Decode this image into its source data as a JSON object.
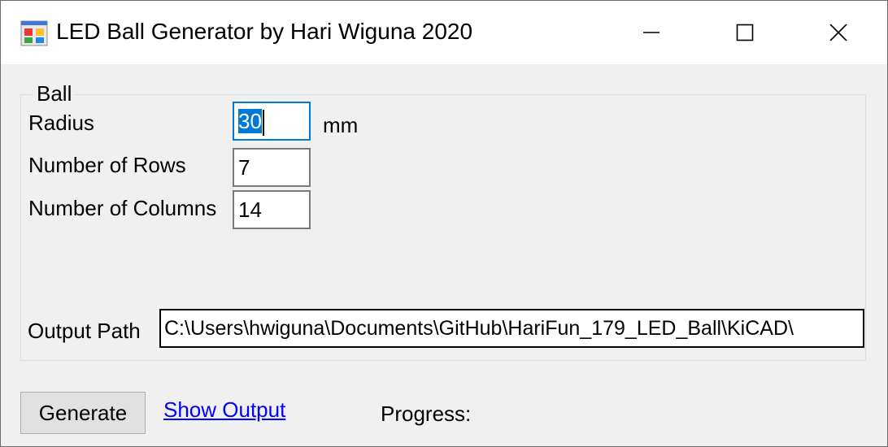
{
  "window": {
    "title": "LED Ball Generator by Hari Wiguna 2020",
    "icon": "app-form-icon",
    "controls": [
      "minimize-icon",
      "maximize-icon",
      "close-icon"
    ]
  },
  "ball_group": {
    "title": "Ball",
    "radius_label": "Radius",
    "radius_value": "30",
    "radius_unit": "mm",
    "rows_label": "Number of Rows",
    "rows_value": "7",
    "columns_label": "Number of Columns",
    "columns_value": "14",
    "output_path_label": "Output Path",
    "output_path_value": "C:\\Users\\hwiguna\\Documents\\GitHub\\HariFun_179_LED_Ball\\KiCAD\\"
  },
  "footer": {
    "generate_label": "Generate",
    "show_output_label": "Show Output",
    "progress_label": "Progress:"
  },
  "colors": {
    "selection": "#0078d7",
    "link": "#0000ff",
    "window_bg": "#f0f0f0"
  }
}
